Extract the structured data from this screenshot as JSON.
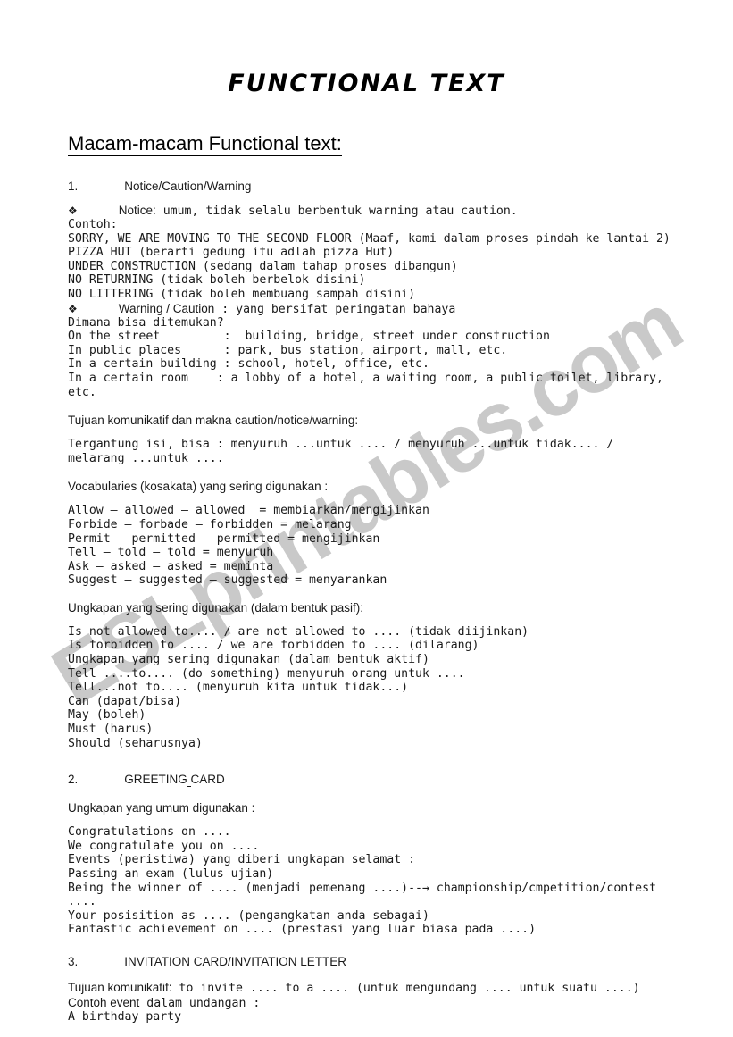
{
  "document": {
    "title": "FUNCTIONAL TEXT",
    "heading": "Macam-macam Functional text:",
    "watermark": "ESLprintables.com",
    "watermark_color": "#c9c9c9"
  },
  "sections": {
    "notice": {
      "number": "1.",
      "label": "Notice/Caution/Warning",
      "bullet_glyph": "❖",
      "bullet_notice_label": "Notice:",
      "bullet_notice_rest": " umum, tidak selalu berbentuk warning atau caution.",
      "contoh_label": "Contoh:",
      "examples": "SORRY, WE ARE MOVING TO THE SECOND FLOOR (Maaf, kami dalam proses pindah ke lantai 2)\nPIZZA HUT (berarti gedung itu adlah pizza Hut)\nUNDER CONSTRUCTION (sedang dalam tahap proses dibangun)\nNO RETURNING (tidak boleh berbelok disini)\nNO LITTERING (tidak boleh membuang sampah disini)",
      "bullet_warning_label": "Warning / Caution",
      "bullet_warning_rest": " : yang bersifat peringatan bahaya",
      "places": "Dimana bisa ditemukan?\nOn the street         :  building, bridge, street under construction\nIn public places      : park, bus station, airport, mall, etc.\nIn a certain building : school, hotel, office, etc.\nIn a certain room    : a lobby of a hotel, a waiting room, a public toilet, library, etc.",
      "tujuan_heading": "Tujuan komunikatif dan makna caution/notice/warning:",
      "tujuan_body": "Tergantung isi, bisa : menyuruh ...untuk .... / menyuruh ...untuk tidak.... / melarang ...untuk ....",
      "vocab_heading": "Vocabularies (kosakata) yang sering digunakan :",
      "vocab_body": "Allow – allowed – allowed  = membiarkan/mengijinkan\nForbide – forbade – forbidden = melarang\nPermit – permitted – permitted = mengijinkan\nTell – told – told = menyuruh\nAsk – asked – asked = meminta\nSuggest – suggested – suggested = menyarankan",
      "pasif_heading": "Ungkapan yang sering digunakan (dalam bentuk pasif):",
      "pasif_body": "Is not allowed to.... / are not allowed to .... (tidak diijinkan)\nIs forbidden to .... / we are forbidden to .... (dilarang)\nUngkapan yang sering digunakan (dalam bentuk aktif)\nTell ....to.... (do something) menyuruh orang untuk ....\nTell...not to.... (menyuruh kita untuk tidak...)\nCan (dapat/bisa)\nMay (boleh)\nMust (harus)\nShould (seharusnya)"
    },
    "greeting": {
      "number": "2.",
      "label_part1": "GREETING",
      "label_part2": "CARD",
      "ungkapan_heading": "Ungkapan yang umum digunakan :",
      "body_before_arrow": "Congratulations on ....\nWe congratulate you on ....\nEvents (peristiwa) yang diberi ungkapan selamat :\nPassing an exam (lulus ujian)\nBeing the winner of .... (menjadi pemenang ....)--",
      "arrow_glyph": "→",
      "body_after_arrow": " championship/cmpetition/contest ....\nYour posisition as .... (pengangkatan anda sebagai)\nFantastic achievement on .... (prestasi yang luar biasa pada ....)"
    },
    "invitation": {
      "number": "3.",
      "label": "INVITATION CARD/INVITATION LETTER",
      "tujuan_sans": "Tujuan komunikatif:",
      "tujuan_mono": " to invite .... to a .... (untuk mengundang .... untuk suatu ....)",
      "contoh_sans": "Contoh event",
      "contoh_mono": " dalam undangan :",
      "last_line": "A birthday party"
    }
  }
}
